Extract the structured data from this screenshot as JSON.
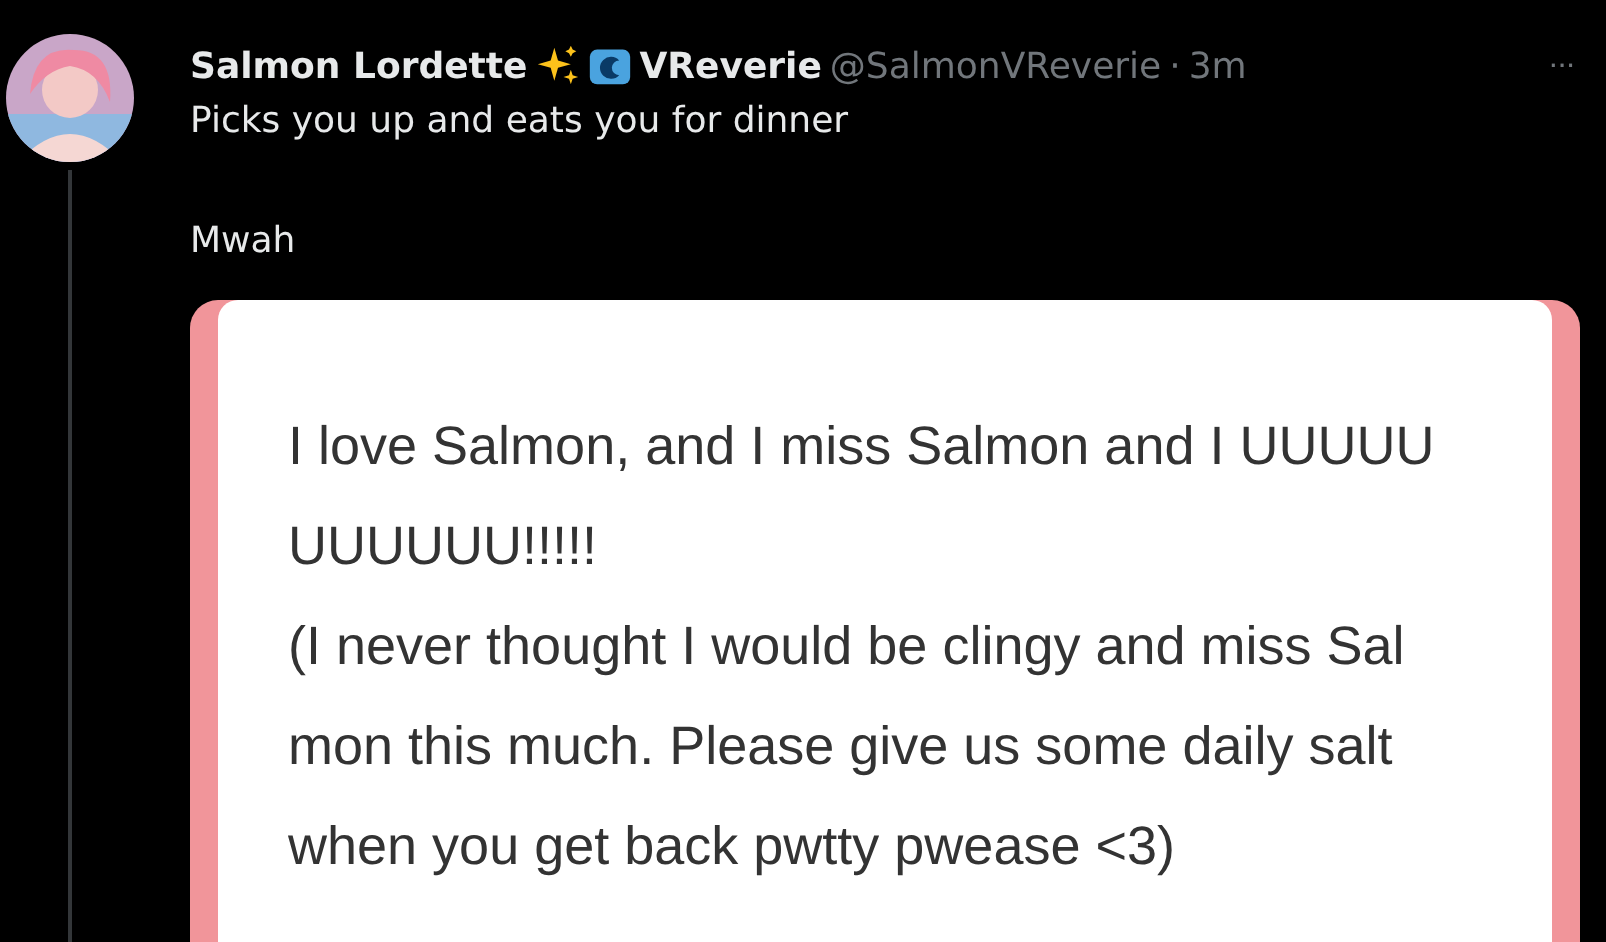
{
  "post": {
    "display_name_before": "Salmon Lordette",
    "display_name_after": "VReverie",
    "handle": "@SalmonVReverie",
    "separator": "·",
    "time": "3m",
    "more": "···",
    "text_lines": [
      "Picks you up and eats you for dinner",
      "Mwah"
    ],
    "image_card": {
      "lines": [
        "I love Salmon, and I miss Salmon and I UUUUU",
        "UUUUUU!!!!!",
        "(I never thought I would be clingy and miss Sal",
        "mon this much. Please give us some daily salt",
        "when you get back pwtty pwease <3)"
      ]
    }
  }
}
